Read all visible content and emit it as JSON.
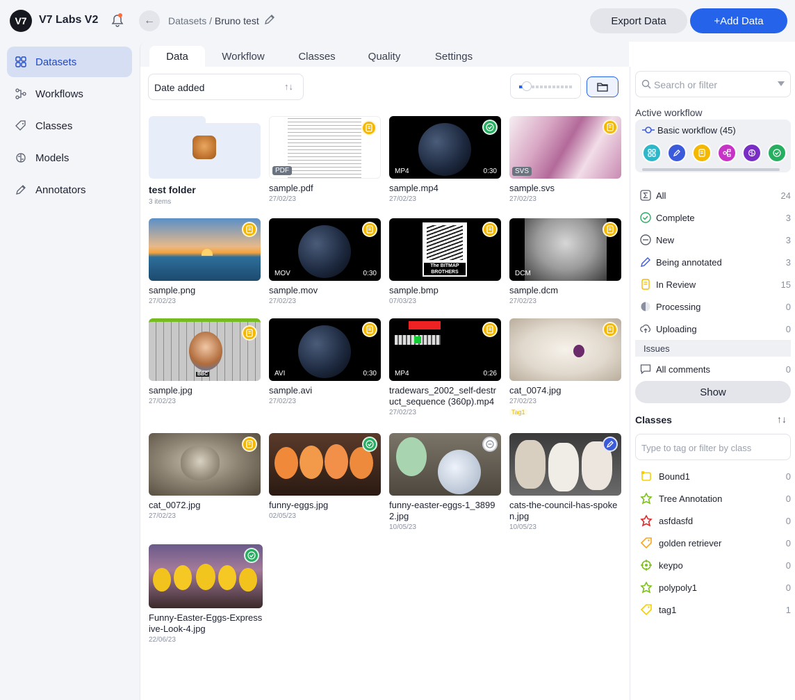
{
  "app": {
    "org_name": "V7 Labs V2",
    "logo_text": "V7"
  },
  "breadcrumb": {
    "root": "Datasets",
    "separator": "/",
    "current": "Bruno test"
  },
  "actions": {
    "export": "Export Data",
    "add": "+Add Data"
  },
  "sidebar": {
    "items": [
      {
        "label": "Datasets",
        "icon": "datasets-icon",
        "active": true
      },
      {
        "label": "Workflows",
        "icon": "workflows-icon"
      },
      {
        "label": "Classes",
        "icon": "tag-icon"
      },
      {
        "label": "Models",
        "icon": "brain-icon"
      },
      {
        "label": "Annotators",
        "icon": "annotators-icon"
      }
    ]
  },
  "tabs": [
    "Data",
    "Workflow",
    "Classes",
    "Quality",
    "Settings"
  ],
  "sort": {
    "label": "Date added"
  },
  "folder": {
    "name": "test folder",
    "count": "3 items"
  },
  "files": [
    {
      "name": "sample.pdf",
      "date": "27/02/23",
      "format": "PDF",
      "status": "review"
    },
    {
      "name": "sample.mp4",
      "date": "27/02/23",
      "format": "MP4",
      "duration": "0:30",
      "status": "complete"
    },
    {
      "name": "sample.svs",
      "date": "27/02/23",
      "format": "SVS",
      "status": "review"
    },
    {
      "name": "sample.png",
      "date": "27/02/23",
      "status": "review"
    },
    {
      "name": "sample.mov",
      "date": "27/02/23",
      "format": "MOV",
      "duration": "0:30",
      "status": "review"
    },
    {
      "name": "sample.bmp",
      "date": "07/03/23",
      "status": "review",
      "thumb_text": "The BITMAP BROTHERS"
    },
    {
      "name": "sample.dcm",
      "date": "27/02/23",
      "format": "DCM",
      "status": "review"
    },
    {
      "name": "sample.jpg",
      "date": "27/02/23",
      "status": "review",
      "thumb_text": "BBC"
    },
    {
      "name": "sample.avi",
      "date": "27/02/23",
      "format": "AVI",
      "duration": "0:30",
      "status": "review"
    },
    {
      "name": "tradewars_2002_self-destruct_sequence (360p).mp4",
      "date": "27/02/23",
      "format": "MP4",
      "duration": "0:26",
      "status": "review"
    },
    {
      "name": "cat_0074.jpg",
      "date": "27/02/23",
      "status": "review",
      "tag": "Tag1"
    },
    {
      "name": "cat_0072.jpg",
      "date": "27/02/23",
      "status": "review"
    },
    {
      "name": "funny-eggs.jpg",
      "date": "02/05/23",
      "status": "complete"
    },
    {
      "name": "funny-easter-eggs-1_38992.jpg",
      "date": "10/05/23",
      "status": "new"
    },
    {
      "name": "cats-the-council-has-spoken.jpg",
      "date": "10/05/23",
      "status": "annotate"
    },
    {
      "name": "Funny-Easter-Eggs-Expressive-Look-4.jpg",
      "date": "22/06/23",
      "status": "complete"
    }
  ],
  "right_panel": {
    "search_placeholder": "Search or filter",
    "active_workflow_title": "Active workflow",
    "workflow_name": "Basic workflow (45)",
    "statuses": [
      {
        "label": "All",
        "count": "24"
      },
      {
        "label": "Complete",
        "count": "3"
      },
      {
        "label": "New",
        "count": "3"
      },
      {
        "label": "Being annotated",
        "count": "3"
      },
      {
        "label": "In Review",
        "count": "15"
      },
      {
        "label": "Processing",
        "count": "0"
      },
      {
        "label": "Uploading",
        "count": "0"
      }
    ],
    "issues_label": "Issues",
    "comments": {
      "label": "All comments",
      "count": "0"
    },
    "show_button": "Show",
    "classes_title": "Classes",
    "classes_placeholder": "Type to tag or filter by class",
    "classes": [
      {
        "label": "Bound1",
        "count": "0",
        "color": "#f5d000"
      },
      {
        "label": "Tree Annotation",
        "count": "0",
        "color": "#7cc01b"
      },
      {
        "label": "asfdasfd",
        "count": "0",
        "color": "#d92b2b"
      },
      {
        "label": "golden retriever",
        "count": "0",
        "color": "#f5a623"
      },
      {
        "label": "keypo",
        "count": "0",
        "color": "#7cc01b"
      },
      {
        "label": "polypoly1",
        "count": "0",
        "color": "#7cc01b"
      },
      {
        "label": "tag1",
        "count": "1",
        "color": "#f5d000"
      }
    ]
  },
  "colors": {
    "accent": "#2563eb",
    "review": "#f5b800",
    "complete": "#27ae60",
    "annotate": "#3b5bdb",
    "new": "#c9ccd4"
  }
}
